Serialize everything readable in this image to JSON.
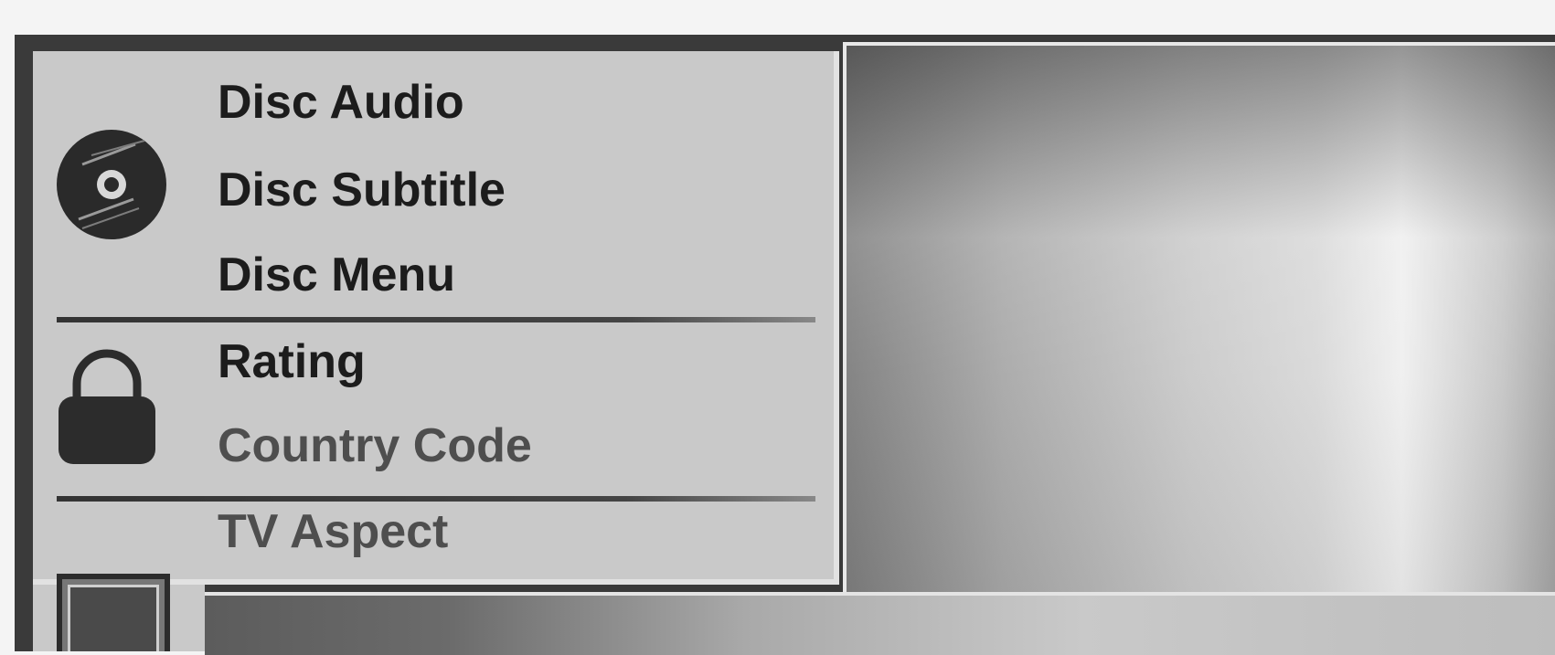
{
  "menu": {
    "groups": [
      {
        "icon": "disc-icon",
        "items": [
          {
            "label": "Disc Audio"
          },
          {
            "label": "Disc Subtitle"
          },
          {
            "label": "Disc Menu"
          }
        ]
      },
      {
        "icon": "lock-icon",
        "items": [
          {
            "label": "Rating"
          },
          {
            "label": "Country Code"
          }
        ]
      },
      {
        "icon": "tv-screen-icon",
        "items": [
          {
            "label": "TV Aspect"
          }
        ]
      }
    ]
  }
}
